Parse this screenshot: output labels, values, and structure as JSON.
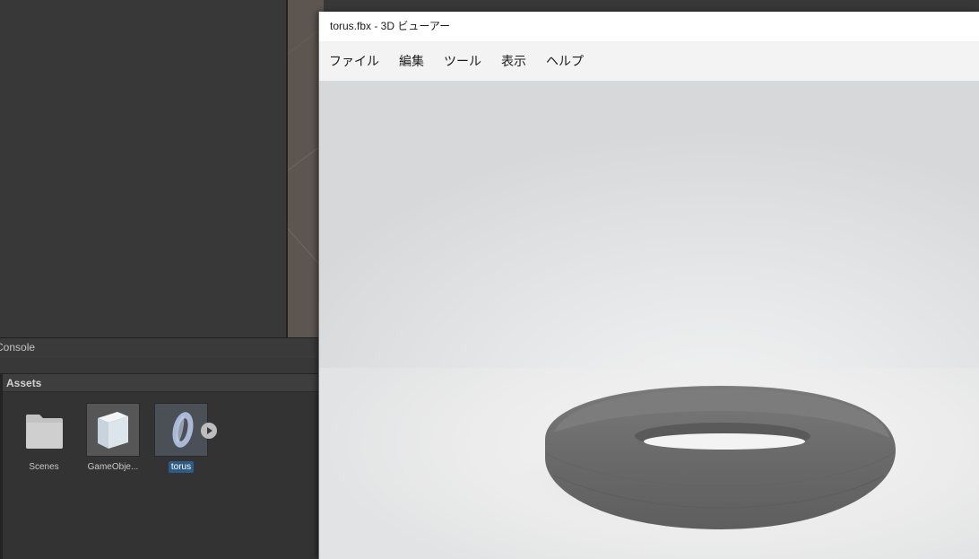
{
  "editor": {
    "console_tab_label": "Console",
    "assets_header": "Assets",
    "assets": [
      {
        "label": "Scenes",
        "icon": "folder-icon"
      },
      {
        "label": "GameObje...",
        "icon": "cube-icon"
      },
      {
        "label": "torus",
        "icon": "torus-icon",
        "selected": true
      }
    ]
  },
  "viewer": {
    "title": "torus.fbx - 3D ビューアー",
    "menu": [
      "ファイル",
      "編集",
      "ツール",
      "表示",
      "ヘルプ"
    ],
    "model_color": "#6a6a6a",
    "background_color": "#e6e7e8"
  }
}
